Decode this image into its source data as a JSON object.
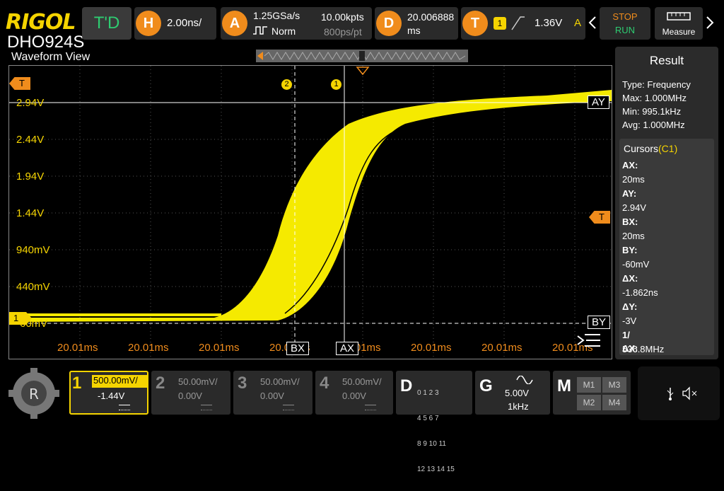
{
  "header": {
    "brand": "RIGOL",
    "model": "DHO924S",
    "td_label": "T'D",
    "horizontal": {
      "badge": "H",
      "value": "2.00ns/"
    },
    "acquire": {
      "badge": "A",
      "rate": "1.25GSa/s",
      "mode": "Norm",
      "points": "10.00kpts",
      "per_pt": "800ps/pt"
    },
    "delay": {
      "badge": "D",
      "value": "20.006888",
      "unit": "ms"
    },
    "trigger": {
      "badge": "T",
      "source": "1",
      "level": "1.36V",
      "mode": "A"
    },
    "stop_label": "STOP",
    "run_label": "RUN",
    "measure_label": "Measure"
  },
  "waveform": {
    "title": "Waveform View",
    "y_labels": [
      "2.94V",
      "2.44V",
      "1.94V",
      "1.44V",
      "940mV",
      "440mV",
      "-60mV"
    ],
    "x_labels": [
      "20.01ms",
      "20.01ms",
      "20.01ms",
      "20.01ms",
      "20.01ms",
      "20.01ms",
      "20.01ms",
      "20.01ms"
    ],
    "trigger_marker": "T",
    "channel_marker": "1",
    "cursor_ay": "AY",
    "cursor_by": "BY",
    "cursor_ax": "AX",
    "cursor_bx": "BX",
    "marker_2": "2",
    "marker_1": "1",
    "trace_color": "#f5ea00"
  },
  "result": {
    "title": "Result",
    "type_label": "Type:",
    "type_value": "Frequency",
    "max_label": "Max:",
    "max_value": "1.000MHz",
    "min_label": "Min:",
    "min_value": "995.1kHz",
    "avg_label": "Avg:",
    "avg_value": "1.000MHz",
    "cursors_title": "Cursors",
    "cursors_ch": "(C1)",
    "items": [
      {
        "label": "AX:",
        "value": "20ms"
      },
      {
        "label": "AY:",
        "value": "2.94V"
      },
      {
        "label": "BX:",
        "value": "20ms"
      },
      {
        "label": "BY:",
        "value": "-60mV"
      },
      {
        "label": "ΔX:",
        "value": "-1.862ns"
      },
      {
        "label": "ΔY:",
        "value": "-3V"
      },
      {
        "label": "1/ΔX:",
        "value": "536.8MHz"
      }
    ]
  },
  "channels": [
    {
      "num": "1",
      "scale": "500.00mV/",
      "offset": "-1.44V"
    },
    {
      "num": "2",
      "scale": "50.00mV/",
      "offset": "0.00V"
    },
    {
      "num": "3",
      "scale": "50.00mV/",
      "offset": "0.00V"
    },
    {
      "num": "4",
      "scale": "50.00mV/",
      "offset": "0.00V"
    }
  ],
  "digital": {
    "label": "D",
    "rows": [
      "0 1 2 3",
      "4 5 6 7",
      "8 9 10 11",
      "12 13 14 15"
    ]
  },
  "generator": {
    "label": "G",
    "amp": "5.00V",
    "freq": "1kHz"
  },
  "math": {
    "label": "M",
    "m1": "M1",
    "m2": "M2",
    "m3": "M3",
    "m4": "M4"
  }
}
